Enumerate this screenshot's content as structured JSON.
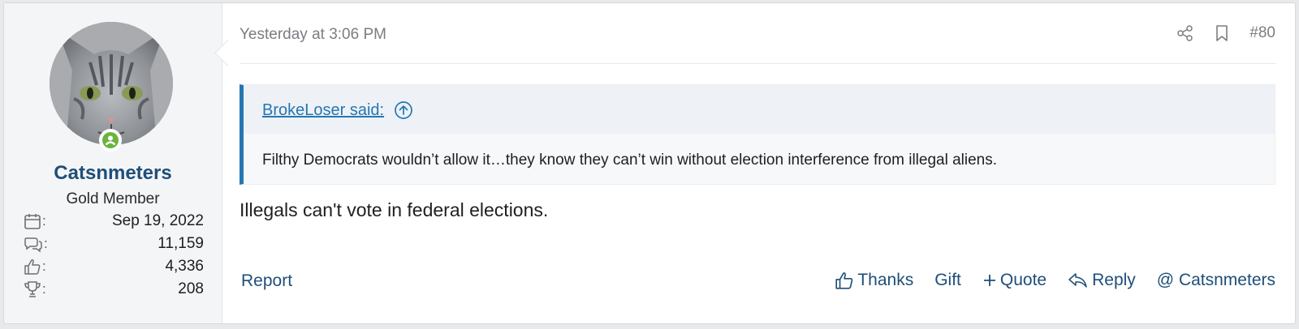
{
  "post": {
    "user": {
      "name": "Catsnmeters",
      "title": "Gold Member",
      "avatar_icon": "cat-avatar",
      "online_icon": "online-status-icon",
      "stats": [
        {
          "icon": "calendar-icon",
          "value": "Sep 19, 2022"
        },
        {
          "icon": "messages-icon",
          "value": "11,159"
        },
        {
          "icon": "reactions-icon",
          "value": "4,336"
        },
        {
          "icon": "trophy-icon",
          "value": "208"
        }
      ]
    },
    "date": "Yesterday at 3:06 PM",
    "number": "#80",
    "quote": {
      "author": "BrokeLoser said:",
      "text": "Filthy Democrats wouldn’t allow it…they know they can’t win without election interference from illegal aliens."
    },
    "body": "Illegals can't vote in federal elections.",
    "actions": {
      "report": "Report",
      "thanks": "Thanks",
      "gift": "Gift",
      "quote": "Quote",
      "reply": "Reply",
      "mention": "@ Catsnmeters"
    }
  },
  "colors": {
    "link": "#2577b1",
    "username": "#1f4e79",
    "online": "#6bb33e",
    "quote_bar": "#2577b1"
  }
}
